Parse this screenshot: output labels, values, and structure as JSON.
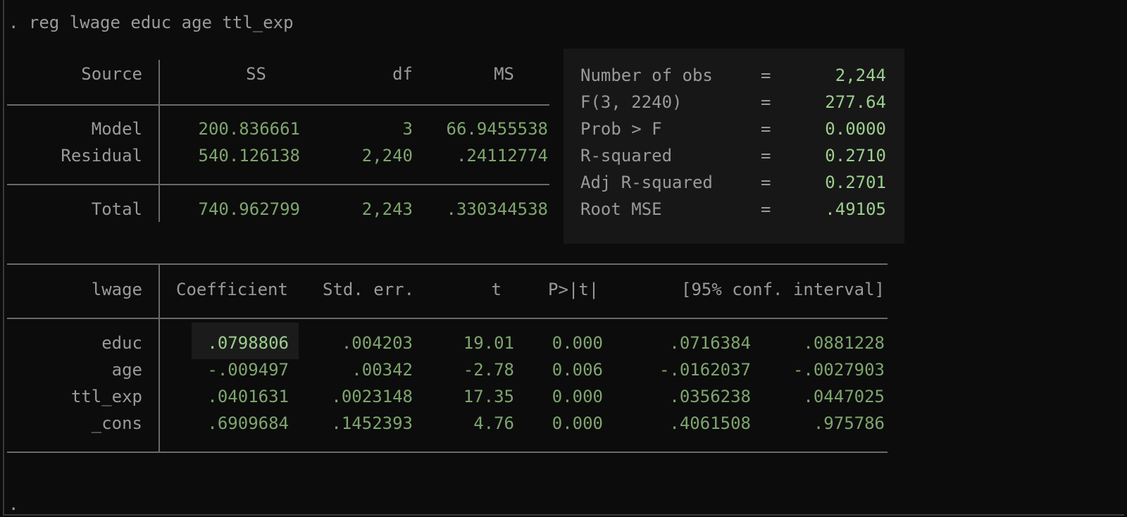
{
  "command": ". reg lwage educ age ttl_exp",
  "prompt": ".",
  "anova": {
    "headers": [
      "Source",
      "SS",
      "df",
      "MS"
    ],
    "rows": [
      {
        "source": "Model",
        "ss": "200.836661",
        "df": "3",
        "ms": "66.9455538"
      },
      {
        "source": "Residual",
        "ss": "540.126138",
        "df": "2,240",
        "ms": ".24112774"
      },
      {
        "source": "Total",
        "ss": "740.962799",
        "df": "2,243",
        "ms": ".330344538"
      }
    ]
  },
  "stats": [
    {
      "label": "Number of obs",
      "eq": "=",
      "value": "2,244"
    },
    {
      "label": "F(3, 2240)",
      "eq": "=",
      "value": "277.64"
    },
    {
      "label": "Prob > F",
      "eq": "=",
      "value": "0.0000"
    },
    {
      "label": "R-squared",
      "eq": "=",
      "value": "0.2710"
    },
    {
      "label": "Adj R-squared",
      "eq": "=",
      "value": "0.2701"
    },
    {
      "label": "Root MSE",
      "eq": "=",
      "value": ".49105"
    }
  ],
  "coef": {
    "headers": {
      "var": "lwage",
      "coef": "Coefficient",
      "se": "Std. err.",
      "t": "t",
      "p": "P>|t|",
      "ci": "[95% conf. interval]"
    },
    "rows": [
      {
        "var": "educ",
        "coef": ".0798806",
        "se": ".004203",
        "t": "19.01",
        "p": "0.000",
        "lo": ".0716384",
        "hi": ".0881228"
      },
      {
        "var": "age",
        "coef": "-.009497",
        "se": ".00342",
        "t": "-2.78",
        "p": "0.006",
        "lo": "-.0162037",
        "hi": "-.0027903"
      },
      {
        "var": "ttl_exp",
        "coef": ".0401631",
        "se": ".0023148",
        "t": "17.35",
        "p": "0.000",
        "lo": ".0356238",
        "hi": ".0447025"
      },
      {
        "var": "_cons",
        "coef": ".6909684",
        "se": ".1452393",
        "t": "4.76",
        "p": "0.000",
        "lo": ".4061508",
        "hi": ".975786"
      }
    ]
  }
}
